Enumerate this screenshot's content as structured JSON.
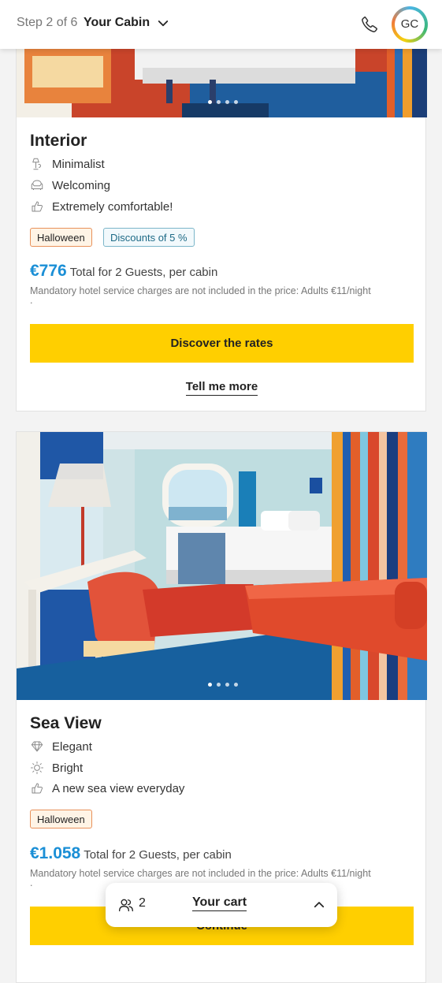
{
  "header": {
    "step": "Step 2 of 6",
    "title": "Your Cabin",
    "avatar_initials": "GC"
  },
  "cabins": [
    {
      "name": "Interior",
      "features": [
        "Minimalist",
        "Welcoming",
        "Extremely comfortable!"
      ],
      "badges": [
        "Halloween",
        "Discounts of 5 %"
      ],
      "price": "€776",
      "price_note": "Total for 2 Guests, per cabin",
      "service_note": "Mandatory hotel service charges are not included in the price: Adults €11/night",
      "service_note_tail": ".",
      "cta_label": "Discover the rates",
      "more_label": "Tell me more"
    },
    {
      "name": "Sea View",
      "features": [
        "Elegant",
        "Bright",
        "A new sea view everyday"
      ],
      "badges": [
        "Halloween"
      ],
      "price": "€1.058",
      "price_note": "Total for 2 Guests, per cabin",
      "service_note": "Mandatory hotel service charges are not included in the price: Adults €11/night",
      "service_note_tail": ".",
      "cta_label": "Continue"
    }
  ],
  "cart": {
    "guests": "2",
    "label": "Your cart"
  },
  "colors": {
    "accent_yellow": "#ffcf00",
    "price_blue": "#1b8fd6",
    "halloween_border": "#e8915a",
    "discount_border": "#7bb6c9"
  }
}
